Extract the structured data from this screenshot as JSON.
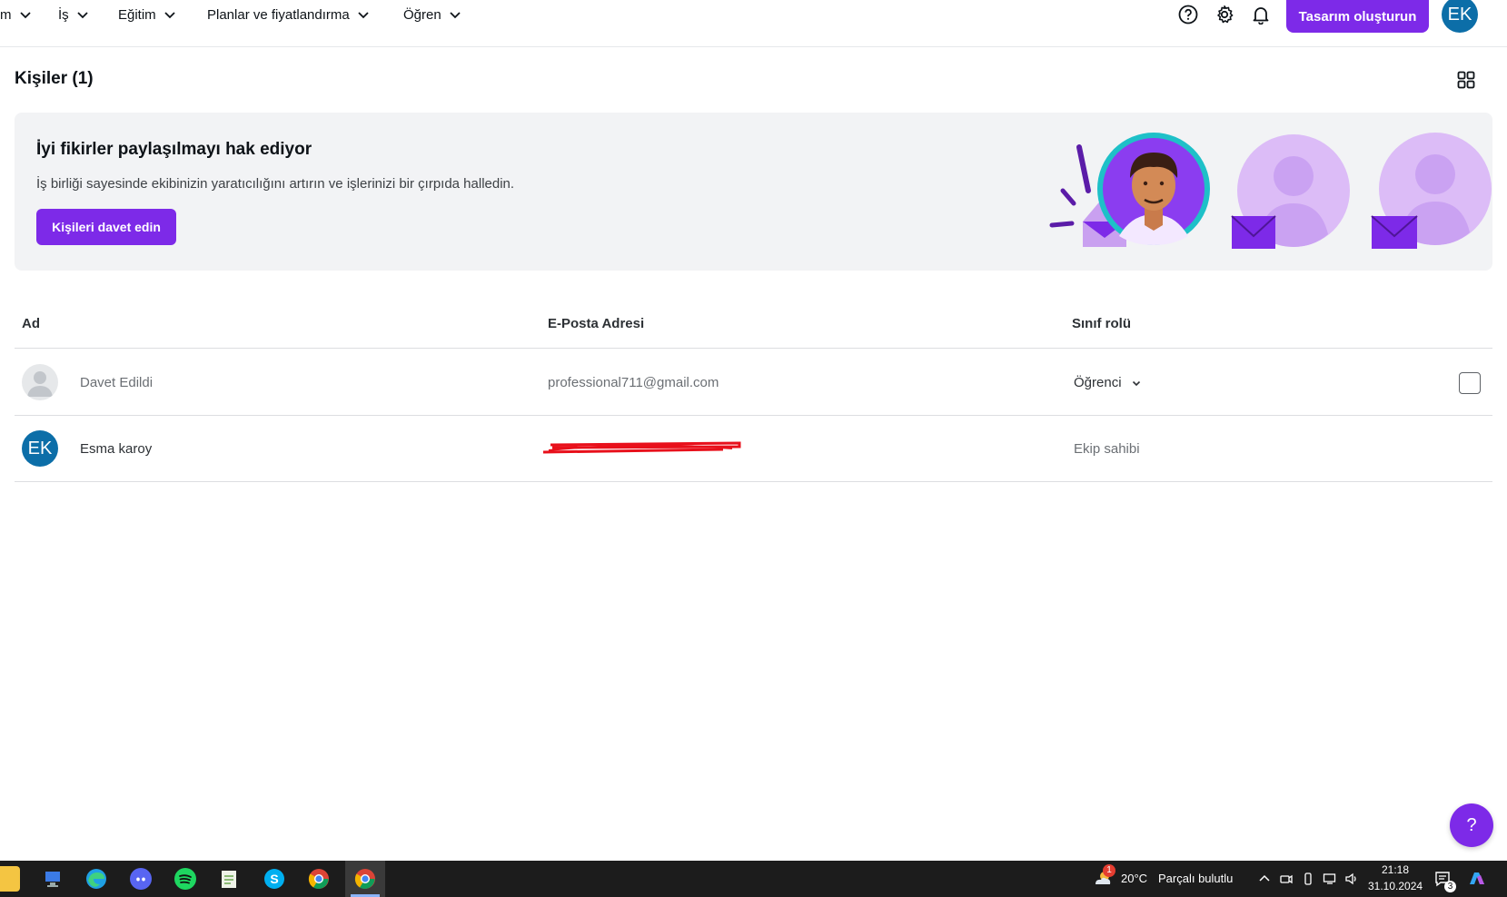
{
  "nav": {
    "items": [
      {
        "label": "m"
      },
      {
        "label": "İş"
      },
      {
        "label": "Eğitim"
      },
      {
        "label": "Planlar ve fiyatlandırma"
      },
      {
        "label": "Öğren"
      }
    ],
    "create_button": "Tasarım oluşturun",
    "avatar_initials": "EK",
    "icons": [
      "help-icon",
      "settings-icon",
      "bell-icon"
    ]
  },
  "page": {
    "title": "Kişiler (1)"
  },
  "banner": {
    "title": "İyi fikirler paylaşılmayı hak ediyor",
    "subtitle": "İş birliği sayesinde ekibinizin yaratıcılığını artırın ve işlerinizi bir çırpıda halledin.",
    "button": "Kişileri davet edin"
  },
  "table": {
    "headers": {
      "name": "Ad",
      "email": "E-Posta Adresi",
      "role": "Sınıf rolü"
    },
    "rows": [
      {
        "name": "Davet Edildi",
        "email": "professional711@gmail.com",
        "role": "Öğrenci",
        "role_editable": true,
        "avatar": "placeholder-avatar"
      },
      {
        "name": "Esma karoy",
        "email": "",
        "role": "Ekip sahibi",
        "role_editable": false,
        "avatar_initials": "EK"
      }
    ]
  },
  "help_fab": "?",
  "taskbar": {
    "weather_temp": "20°C",
    "weather_desc": "Parçalı bulutlu",
    "weather_badge": "1",
    "time": "21:18",
    "date": "31.10.2024",
    "notification_count": "3"
  },
  "colors": {
    "accent": "#7d2ae8",
    "avatar_blue": "#0c6ea8",
    "banner_bg": "#f2f3f5"
  }
}
